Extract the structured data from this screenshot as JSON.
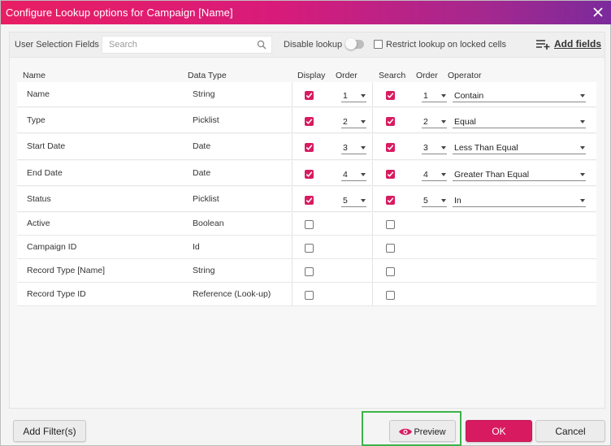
{
  "dialog": {
    "title": "Configure Lookup options for Campaign [Name]"
  },
  "toolbar": {
    "fields_label": "User Selection Fields",
    "search_placeholder": "Search",
    "disable_lookup_label": "Disable lookup",
    "disable_lookup_on": false,
    "restrict_label": "Restrict lookup on locked cells",
    "restrict_checked": false,
    "add_fields_label": "Add fields"
  },
  "columns": {
    "name": "Name",
    "data_type": "Data Type",
    "display": "Display",
    "order": "Order",
    "search": "Search",
    "search_order": "Order",
    "operator": "Operator"
  },
  "rows": [
    {
      "name": "Name",
      "type": "String",
      "display": true,
      "display_order": "1",
      "search": true,
      "search_order": "1",
      "operator": "Contain"
    },
    {
      "name": "Type",
      "type": "Picklist",
      "display": true,
      "display_order": "2",
      "search": true,
      "search_order": "2",
      "operator": "Equal"
    },
    {
      "name": "Start Date",
      "type": "Date",
      "display": true,
      "display_order": "3",
      "search": true,
      "search_order": "3",
      "operator": "Less Than Equal"
    },
    {
      "name": "End Date",
      "type": "Date",
      "display": true,
      "display_order": "4",
      "search": true,
      "search_order": "4",
      "operator": "Greater Than Equal"
    },
    {
      "name": "Status",
      "type": "Picklist",
      "display": true,
      "display_order": "5",
      "search": true,
      "search_order": "5",
      "operator": "In"
    },
    {
      "name": "Active",
      "type": "Boolean",
      "display": false,
      "search": false
    },
    {
      "name": "Campaign ID",
      "type": "Id",
      "display": false,
      "search": false
    },
    {
      "name": "Record Type [Name]",
      "type": "String",
      "display": false,
      "search": false
    },
    {
      "name": "Record Type ID",
      "type": "Reference (Look-up)",
      "display": false,
      "search": false
    }
  ],
  "footer": {
    "add_filter_label": "Add Filter(s)",
    "preview_label": "Preview",
    "ok_label": "OK",
    "cancel_label": "Cancel"
  },
  "colors": {
    "accent": "#d81b60",
    "title_gradient_start": "#e91e63",
    "title_gradient_end": "#7b2a9b",
    "highlight_box": "#3cb34a"
  },
  "icons": [
    "close-icon",
    "search-icon",
    "add-fields-icon",
    "check-icon",
    "chevron-down-icon",
    "eye-icon"
  ]
}
